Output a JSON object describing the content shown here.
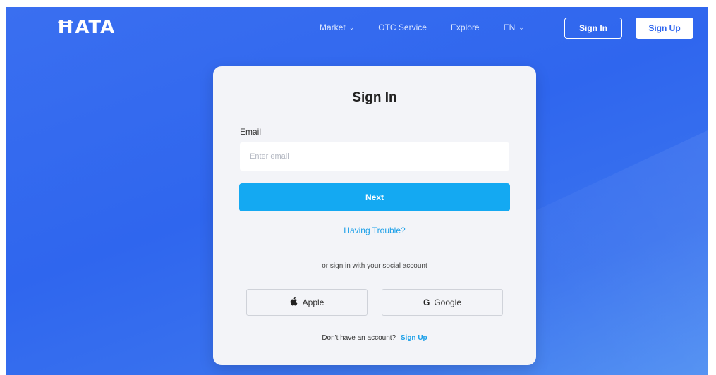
{
  "header": {
    "logo": "ĦATA",
    "nav": {
      "market": "Market",
      "otc": "OTC Service",
      "explore": "Explore",
      "language": "EN"
    },
    "sign_in": "Sign In",
    "sign_up": "Sign Up"
  },
  "card": {
    "title": "Sign In",
    "email_label": "Email",
    "email_placeholder": "Enter email",
    "email_value": "",
    "next": "Next",
    "trouble": "Having Trouble?",
    "divider": "or sign in with your social account",
    "apple": "Apple",
    "google": "Google",
    "google_glyph": "G",
    "apple_glyph": "",
    "no_account": "Don't have an account?",
    "sign_up_link": "Sign Up"
  },
  "icons": [
    "apple-icon",
    "google-icon",
    "chevron-down-icon"
  ],
  "colors": {
    "background": "#2f66ee",
    "primary_button": "#14a9f2",
    "link": "#1a9fe8"
  }
}
